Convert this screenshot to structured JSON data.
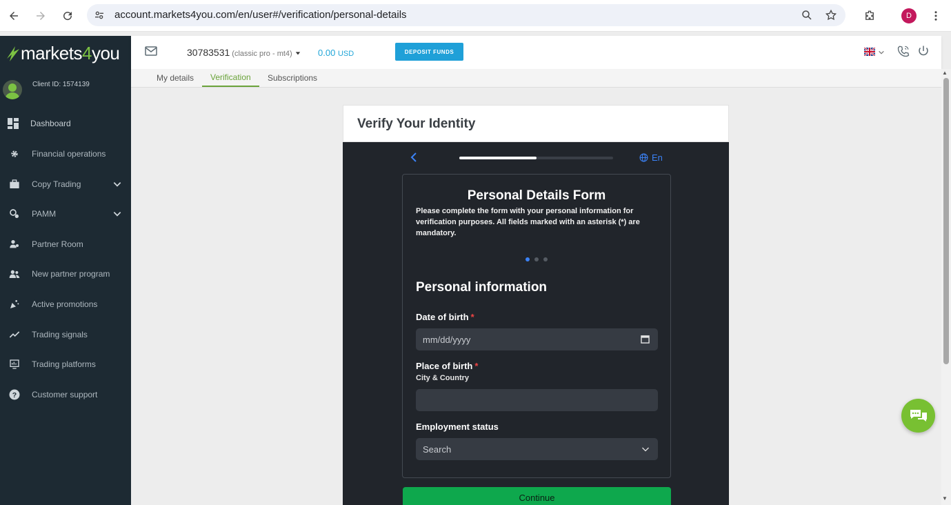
{
  "browser": {
    "url": "account.markets4you.com/en/user#/verification/personal-details",
    "profile_initial": "D"
  },
  "sidebar": {
    "logo_pre": "markets",
    "logo_four": "4",
    "logo_post": "you",
    "client_id": "Client ID: 1574139",
    "items": [
      {
        "label": "Dashboard",
        "icon": "dashboard-icon"
      },
      {
        "label": "Financial operations",
        "icon": "gear-icon"
      },
      {
        "label": "Copy Trading",
        "icon": "briefcase-icon"
      },
      {
        "label": "PAMM",
        "icon": "pamm-icon"
      },
      {
        "label": "Partner Room",
        "icon": "partner-icon"
      },
      {
        "label": "New partner program",
        "icon": "users-icon"
      },
      {
        "label": "Active promotions",
        "icon": "promo-icon"
      },
      {
        "label": "Trading signals",
        "icon": "chart-line-icon"
      },
      {
        "label": "Trading platforms",
        "icon": "platform-icon"
      },
      {
        "label": "Customer support",
        "icon": "help-icon"
      }
    ]
  },
  "header": {
    "account_number": "30783531",
    "account_type": "(classic pro - mt4)",
    "balance": "0.00",
    "currency": "USD",
    "deposit_label": "DEPOSIT FUNDS"
  },
  "tabs": [
    {
      "label": "My details"
    },
    {
      "label": "Verification"
    },
    {
      "label": "Subscriptions"
    }
  ],
  "verify": {
    "title": "Verify Your Identity",
    "lang": "En",
    "progress": 0.5
  },
  "form": {
    "title": "Personal Details Form",
    "description": "Please complete the form with your personal information for verification purposes. All fields marked with an asterisk (*) are mandatory.",
    "section": "Personal information",
    "dob_label": "Date of birth",
    "dob_placeholder": "mm/dd/yyyy",
    "pob_label": "Place of birth",
    "pob_hint": "City & Country",
    "employment_label": "Employment status",
    "employment_placeholder": "Search",
    "required_mark": "*",
    "continue_label": "Continue"
  },
  "colors": {
    "accent_green": "#6aa33a",
    "deposit_blue": "#1fa0d8",
    "continue_green": "#0ea84d",
    "sidebar_bg": "#1d2a33"
  }
}
